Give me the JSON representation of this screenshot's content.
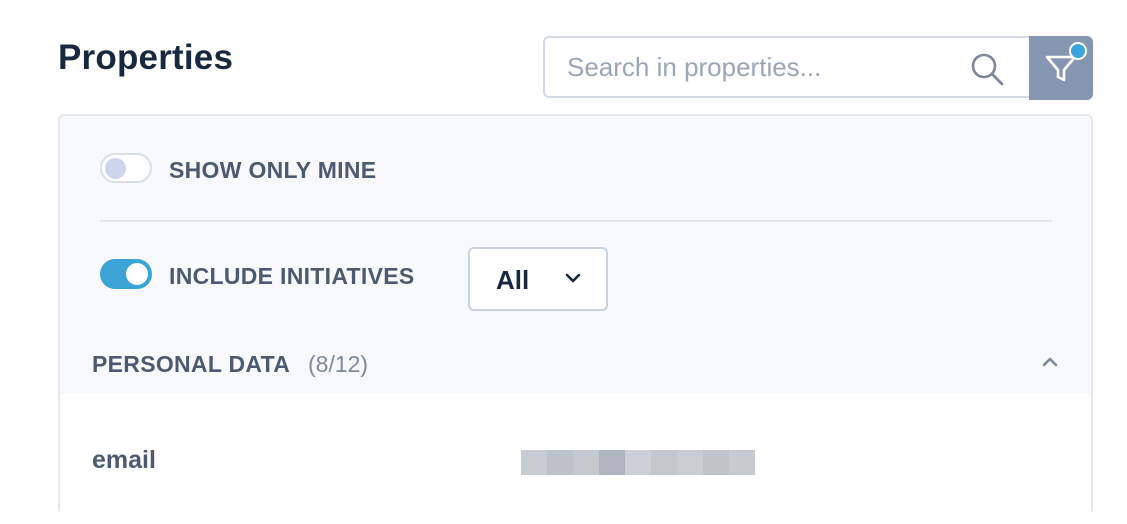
{
  "header": {
    "title": "Properties",
    "search_placeholder": "Search in properties...",
    "search_value": ""
  },
  "filters": {
    "show_only_mine": {
      "label": "SHOW ONLY MINE",
      "checked": false
    },
    "include_initiatives": {
      "label": "INCLUDE INITIATIVES",
      "checked": true
    },
    "initiatives_select": {
      "selected": "All"
    }
  },
  "section": {
    "title": "PERSONAL DATA",
    "count": "(8/12)",
    "expanded": true
  },
  "rows": [
    {
      "name": "email",
      "value_redacted": true
    }
  ],
  "colors": {
    "accent": "#3ba4d6",
    "filter_button": "#8796b0",
    "title_text": "#18293f",
    "label_text": "#4c5a71"
  },
  "icons": {
    "search": "search-icon",
    "filter": "filter-icon",
    "dropdown": "chevron-down-icon",
    "collapse": "chevron-up-icon"
  }
}
